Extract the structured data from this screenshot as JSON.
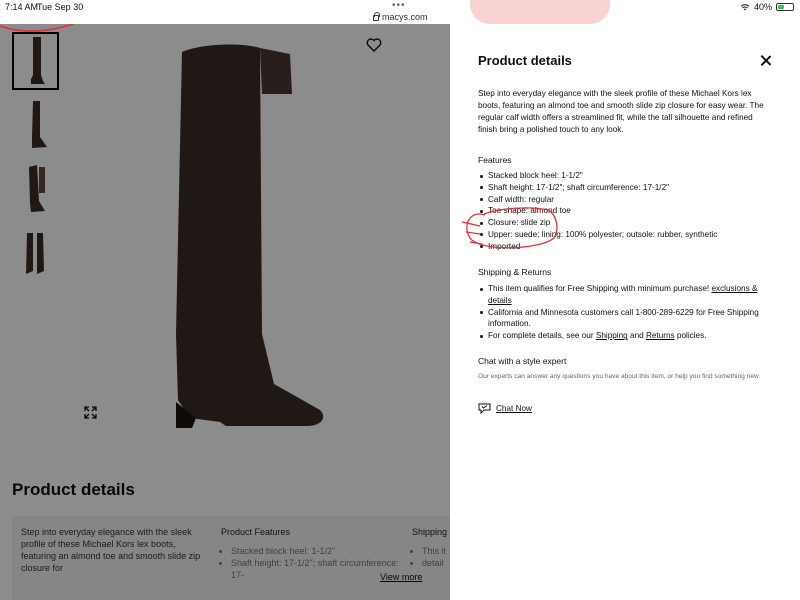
{
  "status_bar": {
    "time": "7:14 AM",
    "date": "Tue Sep 30",
    "dots": "•••",
    "url": "macys.com",
    "battery": "40%",
    "battery_level": 0.4,
    "battery_color": "#35c759"
  },
  "page": {
    "heading": "Product details",
    "description_col": {
      "text": "Step into everyday elegance with the sleek profile of these Michael Kors lex boots, featuring an almond toe and smooth slide zip closure for"
    },
    "features_col": {
      "title": "Product Features",
      "items": [
        "Stacked block heel: 1-1/2\"",
        "Shaft height: 17-1/2\"; shaft circumference: 17-"
      ]
    },
    "shipping_col": {
      "title": "Shipping &",
      "items": [
        "This it",
        "detail"
      ]
    },
    "view_more": "View more",
    "icons": [
      "heart-icon",
      "expand-icon"
    ]
  },
  "panel": {
    "title": "Product details",
    "description": "Step into everyday elegance with the sleek profile of these Michael Kors lex boots, featuring an almond toe and smooth slide zip closure for easy wear. The regular calf width offers a streamlined fit, while the tall silhouette and refined finish bring a polished touch to any look.",
    "features_title": "Features",
    "features": [
      "Stacked block heel: 1-1/2\"",
      "Shaft height: 17-1/2\"; shaft circumference: 17-1/2\"",
      "Calf width: regular",
      "Toe shape: almond toe",
      "Closure: slide zip",
      "Upper: suede; lining: 100% polyester; outsole: rubber, synthetic",
      "Imported"
    ],
    "shipping_title": "Shipping & Returns",
    "shipping": {
      "item1_text": "This item qualifies for Free Shipping with minimum purchase! ",
      "item1_link": "exclusions & details",
      "item2": "California and Minnesota customers call 1-800-289-6229 for Free Shipping information.",
      "item3_pre": "For complete details, see our ",
      "item3_link1": "Shipping",
      "item3_mid": " and ",
      "item3_link2": "Returns",
      "item3_post": " policies."
    },
    "chat_title": "Chat with a style expert",
    "chat_desc": "Our experts can answer any questions you have about this item, or help you find something new.",
    "chat_link": "Chat Now",
    "annotation_color": "#e0323c",
    "boot_color": "#3b2c26"
  }
}
